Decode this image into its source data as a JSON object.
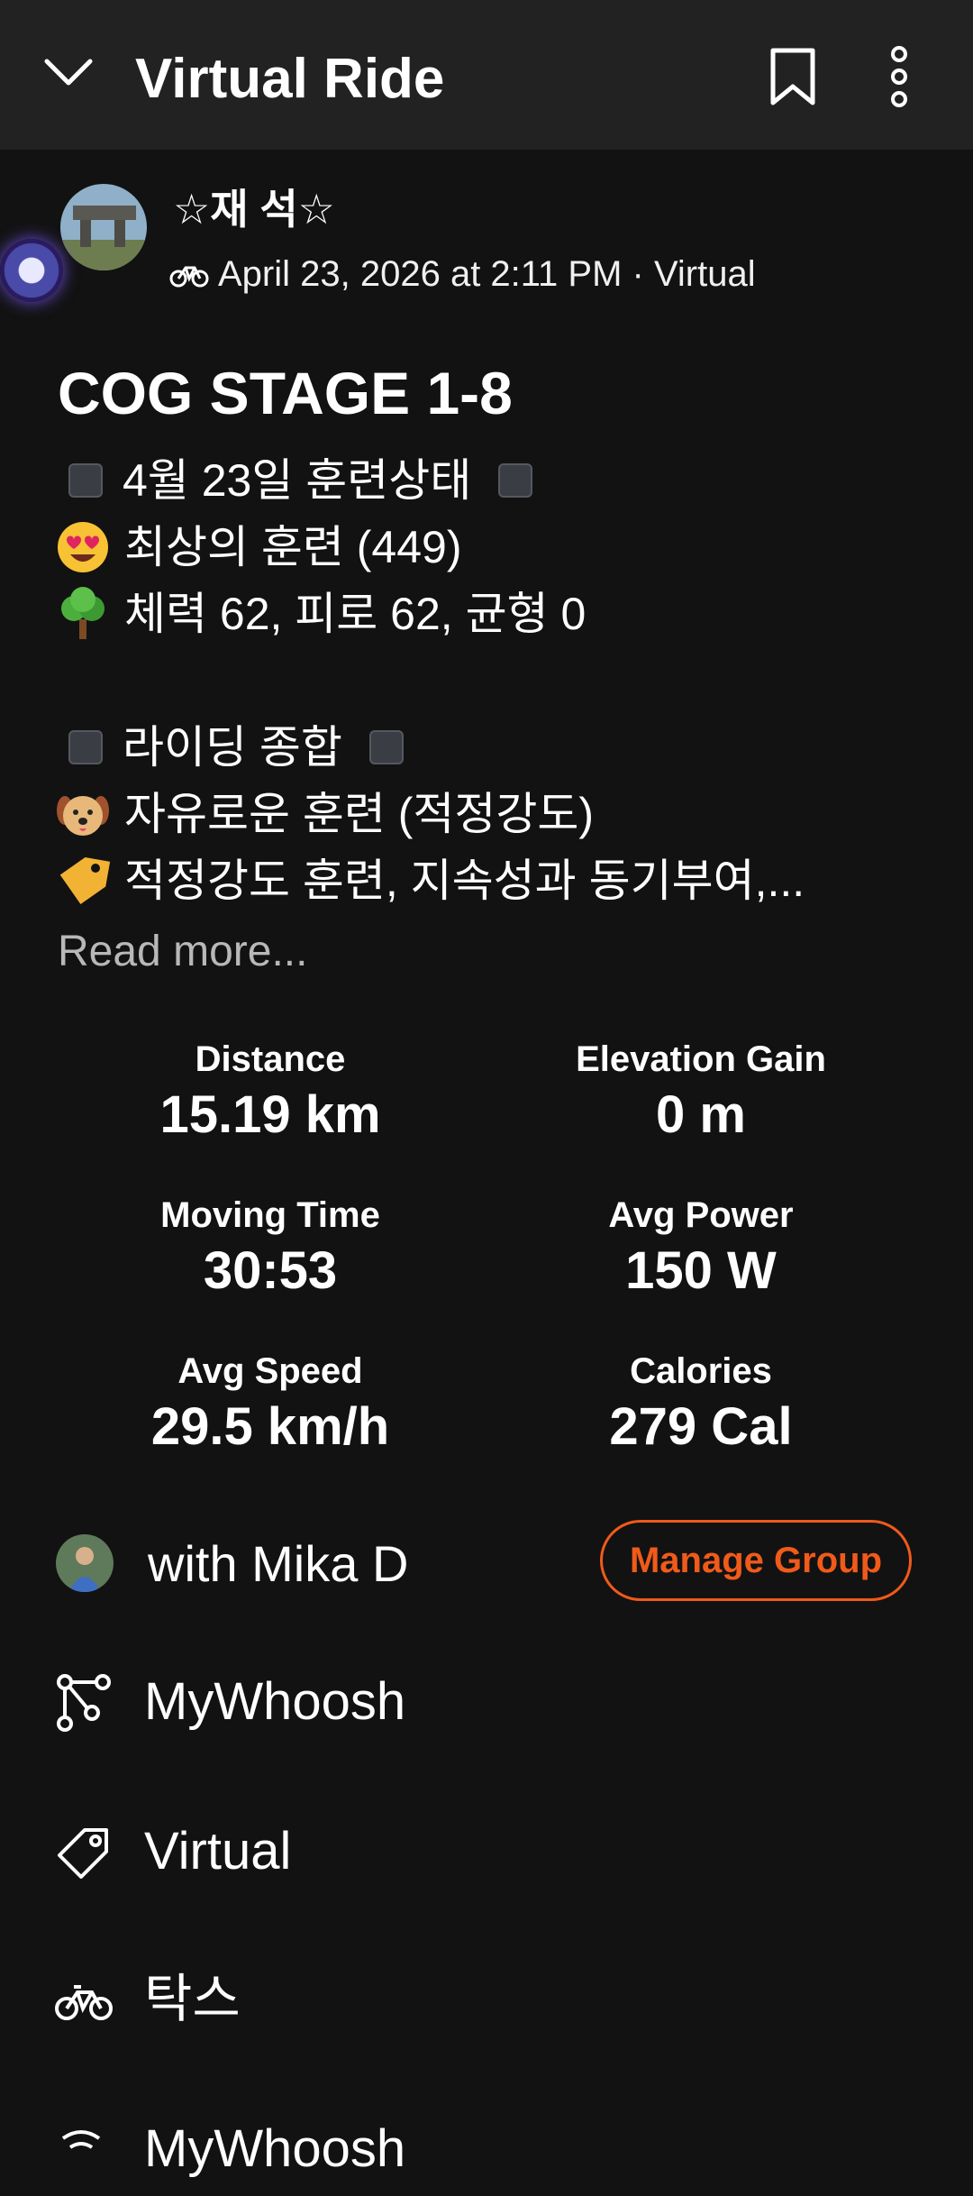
{
  "appbar": {
    "title": "Virtual Ride",
    "icons": [
      "chevron-down-icon",
      "bookmark-icon",
      "more-vertical-icon"
    ]
  },
  "athlete": {
    "name": "☆재 석☆",
    "meta": "April 23, 2026 at 2:11 PM · Virtual"
  },
  "activity": {
    "title": "COG STAGE 1-8",
    "lines": [
      {
        "icon": "square",
        "text": "4월 23일 훈련상태"
      },
      {
        "icon": "heart-eyes-emoji",
        "text": "최상의 훈련 (449)"
      },
      {
        "icon": "tree-emoji",
        "text": "체력 62, 피로 62, 균형 0"
      },
      {
        "icon": "",
        "text": ""
      },
      {
        "icon": "square",
        "text": "라이딩 종합"
      },
      {
        "icon": "dog-emoji",
        "text": "자유로운 훈련 (적정강도)"
      },
      {
        "icon": "tag-emoji",
        "text": "적정강도 훈련, 지속성과 동기부여,..."
      }
    ],
    "read_more": "Read more..."
  },
  "stats": [
    {
      "label": "Distance",
      "value": "15.19 km"
    },
    {
      "label": "Elevation Gain",
      "value": "0 m"
    },
    {
      "label": "Moving Time",
      "value": "30:53"
    },
    {
      "label": "Avg Power",
      "value": "150 W"
    },
    {
      "label": "Avg Speed",
      "value": "29.5 km/h"
    },
    {
      "label": "Calories",
      "value": "279 Cal"
    }
  ],
  "group": {
    "text": "with Mika D",
    "button": "Manage Group"
  },
  "list": [
    {
      "icon": "route-icon",
      "label": "MyWhoosh"
    },
    {
      "icon": "tag-icon",
      "label": "Virtual"
    },
    {
      "icon": "bike-icon",
      "label": "탁스"
    },
    {
      "icon": "device-icon",
      "label": "MyWhoosh"
    }
  ],
  "colors": {
    "background": "#121212",
    "appbar": "#222222",
    "accent": "#f05a1a",
    "muted": "#b8b8b8"
  }
}
